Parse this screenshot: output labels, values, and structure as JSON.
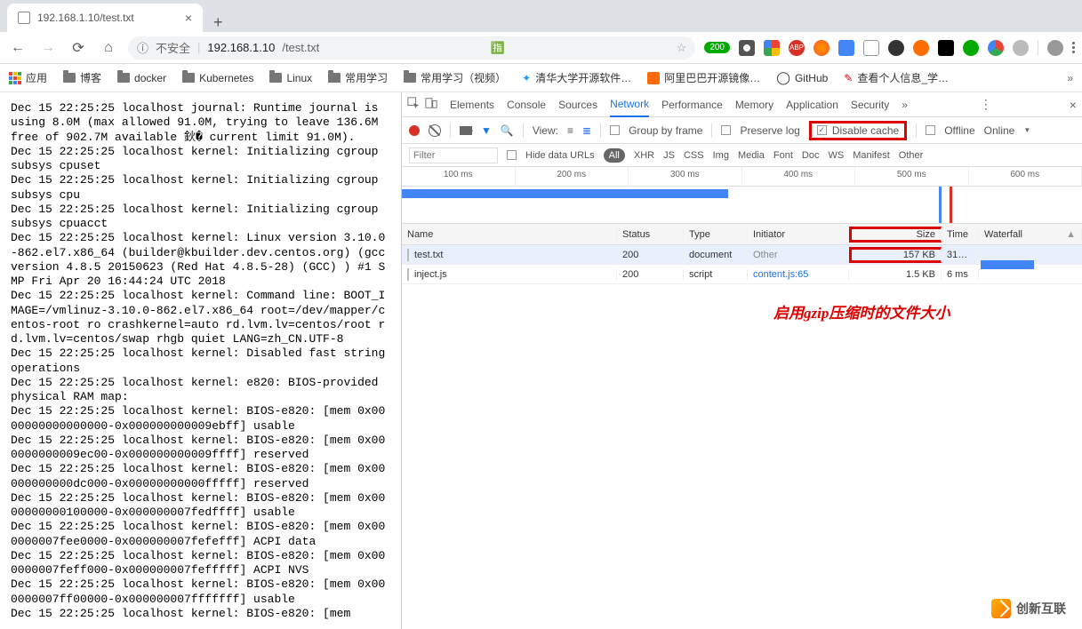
{
  "browser": {
    "tab_title": "192.168.1.10/test.txt",
    "new_tab": "+"
  },
  "addr": {
    "insecure_label": "不安全",
    "host": "192.168.1.10",
    "path": "/test.txt",
    "badge": "200"
  },
  "bookmarks": {
    "apps": "应用",
    "items": [
      "博客",
      "docker",
      "Kubernetes",
      "Linux",
      "常用学习",
      "常用学习（视频）",
      "清华大学开源软件…",
      "阿里巴巴开源镜像…",
      "GitHub",
      "查看个人信息_学…"
    ]
  },
  "page_text": "Dec 15 22:25:25 localhost journal: Runtime journal is using 8.0M (max allowed 91.0M, trying to leave 136.6M free of 902.7M available 鈥� current limit 91.0M).\nDec 15 22:25:25 localhost kernel: Initializing cgroup subsys cpuset\nDec 15 22:25:25 localhost kernel: Initializing cgroup subsys cpu\nDec 15 22:25:25 localhost kernel: Initializing cgroup subsys cpuacct\nDec 15 22:25:25 localhost kernel: Linux version 3.10.0-862.el7.x86_64 (builder@kbuilder.dev.centos.org) (gcc version 4.8.5 20150623 (Red Hat 4.8.5-28) (GCC) ) #1 SMP Fri Apr 20 16:44:24 UTC 2018\nDec 15 22:25:25 localhost kernel: Command line: BOOT_IMAGE=/vmlinuz-3.10.0-862.el7.x86_64 root=/dev/mapper/centos-root ro crashkernel=auto rd.lvm.lv=centos/root rd.lvm.lv=centos/swap rhgb quiet LANG=zh_CN.UTF-8\nDec 15 22:25:25 localhost kernel: Disabled fast string operations\nDec 15 22:25:25 localhost kernel: e820: BIOS-provided physical RAM map:\nDec 15 22:25:25 localhost kernel: BIOS-e820: [mem 0x0000000000000000-0x000000000009ebff] usable\nDec 15 22:25:25 localhost kernel: BIOS-e820: [mem 0x000000000009ec00-0x000000000009ffff] reserved\nDec 15 22:25:25 localhost kernel: BIOS-e820: [mem 0x00000000000dc000-0x00000000000fffff] reserved\nDec 15 22:25:25 localhost kernel: BIOS-e820: [mem 0x0000000000100000-0x000000007fedffff] usable\nDec 15 22:25:25 localhost kernel: BIOS-e820: [mem 0x000000007fee0000-0x000000007fefefff] ACPI data\nDec 15 22:25:25 localhost kernel: BIOS-e820: [mem 0x000000007feff000-0x000000007fefffff] ACPI NVS\nDec 15 22:25:25 localhost kernel: BIOS-e820: [mem 0x000000007ff00000-0x000000007fffffff] usable\nDec 15 22:25:25 localhost kernel: BIOS-e820: [mem",
  "devtools": {
    "tabs": [
      "Elements",
      "Console",
      "Sources",
      "Network",
      "Performance",
      "Memory",
      "Application",
      "Security"
    ],
    "active_tab": "Network",
    "more": "»",
    "toolbar": {
      "view": "View:",
      "group_by_frame": "Group by frame",
      "preserve_log": "Preserve log",
      "disable_cache": "Disable cache",
      "offline": "Offline",
      "online": "Online"
    },
    "filter": {
      "placeholder": "Filter",
      "hide_urls": "Hide data URLs",
      "types": [
        "All",
        "XHR",
        "JS",
        "CSS",
        "Img",
        "Media",
        "Font",
        "Doc",
        "WS",
        "Manifest",
        "Other"
      ]
    },
    "timeline": [
      "100 ms",
      "200 ms",
      "300 ms",
      "400 ms",
      "500 ms",
      "600 ms"
    ],
    "cols": {
      "name": "Name",
      "status": "Status",
      "type": "Type",
      "initiator": "Initiator",
      "size": "Size",
      "time": "Time",
      "waterfall": "Waterfall"
    },
    "rows": [
      {
        "name": "test.txt",
        "status": "200",
        "type": "document",
        "initiator": "Other",
        "size": "157 KB",
        "time": "31…"
      },
      {
        "name": "inject.js",
        "status": "200",
        "type": "script",
        "initiator": "content.js:65",
        "size": "1.5 KB",
        "time": "6 ms"
      }
    ]
  },
  "annotation": "启用gzip压缩时的文件大小",
  "watermark": "创新互联"
}
